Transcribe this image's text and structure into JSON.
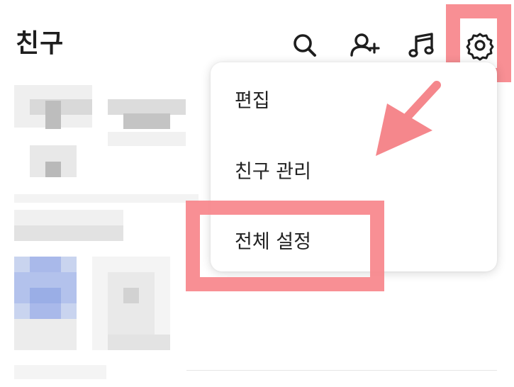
{
  "header": {
    "title": "친구"
  },
  "icons": {
    "search": "search-icon",
    "add_friend": "add-friend-icon",
    "music": "music-note-icon",
    "settings": "gear-icon"
  },
  "menu": {
    "items": [
      {
        "label": "편집"
      },
      {
        "label": "친구 관리"
      },
      {
        "label": "전체 설정"
      }
    ]
  },
  "colors": {
    "highlight": "#f7858b",
    "arrow": "#f5878c"
  }
}
